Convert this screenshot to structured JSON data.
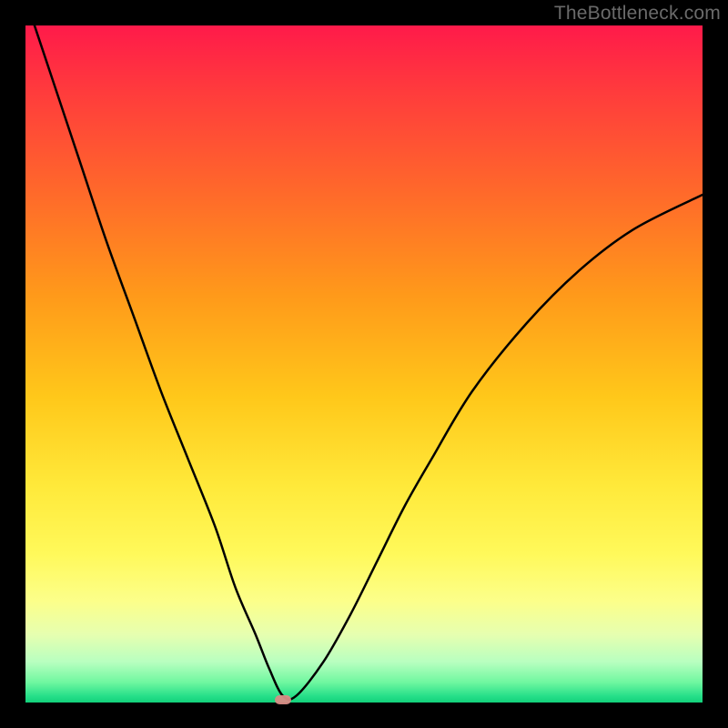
{
  "watermark": "TheBottleneck.com",
  "chart_data": {
    "type": "line",
    "title": "",
    "xlabel": "",
    "ylabel": "",
    "xlim": [
      0,
      100
    ],
    "ylim": [
      0,
      100
    ],
    "grid": false,
    "legend": false,
    "background_gradient": [
      {
        "pos": 0.0,
        "color": "#ff1a4a"
      },
      {
        "pos": 0.5,
        "color": "#ffc81a"
      },
      {
        "pos": 0.8,
        "color": "#fff95a"
      },
      {
        "pos": 1.0,
        "color": "#12d07a"
      }
    ],
    "series": [
      {
        "name": "bottleneck-curve",
        "color": "#000000",
        "x": [
          0,
          4,
          8,
          12,
          16,
          20,
          24,
          28,
          31,
          34,
          36,
          38,
          40,
          44,
          48,
          52,
          56,
          60,
          66,
          74,
          82,
          90,
          100
        ],
        "y": [
          104,
          92,
          80,
          68,
          57,
          46,
          36,
          26,
          17,
          10,
          5,
          1,
          1,
          6,
          13,
          21,
          29,
          36,
          46,
          56,
          64,
          70,
          75
        ]
      }
    ],
    "minimum_point": {
      "x": 38,
      "y": 0,
      "color": "#d98c86"
    }
  }
}
